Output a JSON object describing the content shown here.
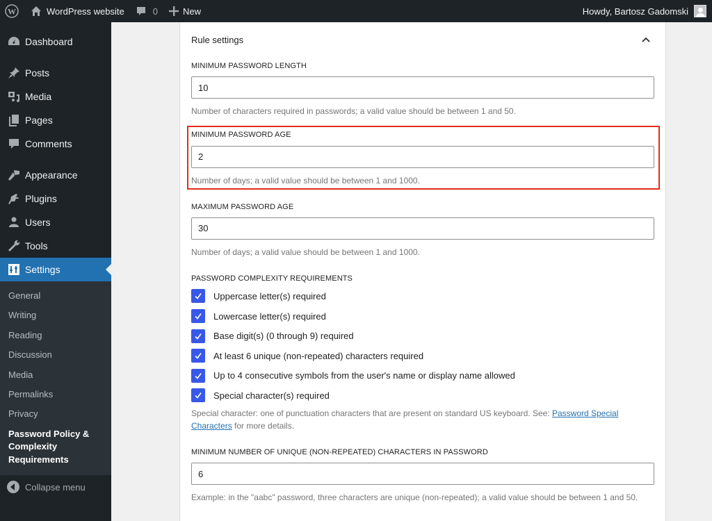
{
  "adminbar": {
    "site_name": "WordPress website",
    "comments_count": "0",
    "new_label": "New",
    "greeting": "Howdy, Bartosz Gadomski"
  },
  "sidebar": {
    "items": [
      {
        "label": "Dashboard",
        "icon": "dashboard-icon"
      },
      {
        "label": "Posts",
        "icon": "pin-icon"
      },
      {
        "label": "Media",
        "icon": "media-icon"
      },
      {
        "label": "Pages",
        "icon": "pages-icon"
      },
      {
        "label": "Comments",
        "icon": "comment-icon"
      },
      {
        "label": "Appearance",
        "icon": "paintbrush-icon"
      },
      {
        "label": "Plugins",
        "icon": "plug-icon"
      },
      {
        "label": "Users",
        "icon": "user-icon"
      },
      {
        "label": "Tools",
        "icon": "wrench-icon"
      },
      {
        "label": "Settings",
        "icon": "sliders-icon",
        "current": true
      }
    ],
    "submenu": [
      "General",
      "Writing",
      "Reading",
      "Discussion",
      "Media",
      "Permalinks",
      "Privacy",
      "Password Policy & Complexity Requirements"
    ],
    "collapse_label": "Collapse menu"
  },
  "panel": {
    "title": "Rule settings",
    "min_length": {
      "label": "Minimum password length",
      "value": "10",
      "help": "Number of characters required in passwords; a valid value should be between 1 and 50."
    },
    "min_age": {
      "label": "Minimum password age",
      "value": "2",
      "help": "Number of days; a valid value should be between 1 and 1000."
    },
    "max_age": {
      "label": "Maximum password age",
      "value": "30",
      "help": "Number of days; a valid value should be between 1 and 1000."
    },
    "complexity": {
      "label": "Password complexity requirements",
      "options": [
        {
          "label": "Uppercase letter(s) required",
          "checked": true
        },
        {
          "label": "Lowercase letter(s) required",
          "checked": true
        },
        {
          "label": "Base digit(s) (0 through 9) required",
          "checked": true
        },
        {
          "label": "At least 6 unique (non-repeated) characters required",
          "checked": true
        },
        {
          "label": "Up to 4 consecutive symbols from the user's name or display name allowed",
          "checked": true
        },
        {
          "label": "Special character(s) required",
          "checked": true
        }
      ],
      "help_prefix": "Special character: one of punctuation characters that are present on standard US keyboard. See: ",
      "help_link": "Password Special Characters",
      "help_suffix": " for more details."
    },
    "min_unique": {
      "label": "Minimum number of unique (non-repeated) characters in password",
      "value": "6",
      "help": "Example: in the \"aabc\" password, three characters are unique (non-repeated); a valid value should be between 1 and 50."
    }
  },
  "colors": {
    "admin_dark": "#1d2327",
    "submenu_bg": "#2c3338",
    "accent": "#2271b1",
    "checkbox": "#3858e9",
    "highlight": "#e02e16"
  }
}
